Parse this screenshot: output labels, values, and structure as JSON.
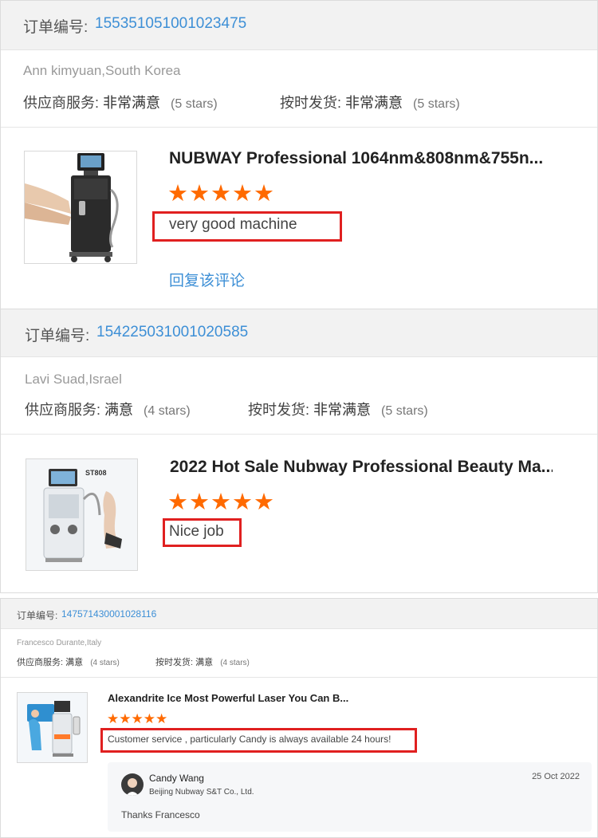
{
  "orders": [
    {
      "order_label": "订单编号:",
      "order_number": "155351051001023475",
      "buyer": "Ann kimyuan,South Korea",
      "supplier_label": "供应商服务:",
      "supplier_value": "非常满意",
      "supplier_stars": "(5 stars)",
      "shipping_label": "按时发货:",
      "shipping_value": "非常满意",
      "shipping_stars": "(5 stars)",
      "product_title": "NUBWAY Professional 1064nm&808nm&755n...",
      "rating": 5,
      "review": "very good machine",
      "reply_link": "回复该评论"
    },
    {
      "order_label": "订单编号:",
      "order_number": "154225031001020585",
      "buyer": "Lavi Suad,Israel",
      "supplier_label": "供应商服务:",
      "supplier_value": "满意",
      "supplier_stars": "(4 stars)",
      "shipping_label": "按时发货:",
      "shipping_value": "非常满意",
      "shipping_stars": "(5 stars)",
      "product_title": "2022 Hot Sale Nubway Professional Beauty Ma...",
      "product_badge": "ST808",
      "rating": 5,
      "review": "Nice job"
    },
    {
      "order_label": "订单编号:",
      "order_number": "147571430001028116",
      "buyer": "Francesco Durante,Italy",
      "supplier_label": "供应商服务:",
      "supplier_value": "满意",
      "supplier_stars": "(4 stars)",
      "shipping_label": "按时发货:",
      "shipping_value": "满意",
      "shipping_stars": "(4 stars)",
      "product_title": "Alexandrite Ice Most Powerful Laser You Can B...",
      "rating": 5,
      "review": "Customer service , particularly Candy is always available 24 hours!",
      "seller_reply": {
        "name": "Candy Wang",
        "company": "Beijing Nubway S&T Co., Ltd.",
        "date": "25 Oct 2022",
        "text": "Thanks Francesco"
      }
    }
  ],
  "colors": {
    "star": "#ff6a00",
    "link": "#3d8fd6",
    "highlight_box": "#e02020"
  },
  "icons": [
    "star-icon",
    "avatar"
  ]
}
